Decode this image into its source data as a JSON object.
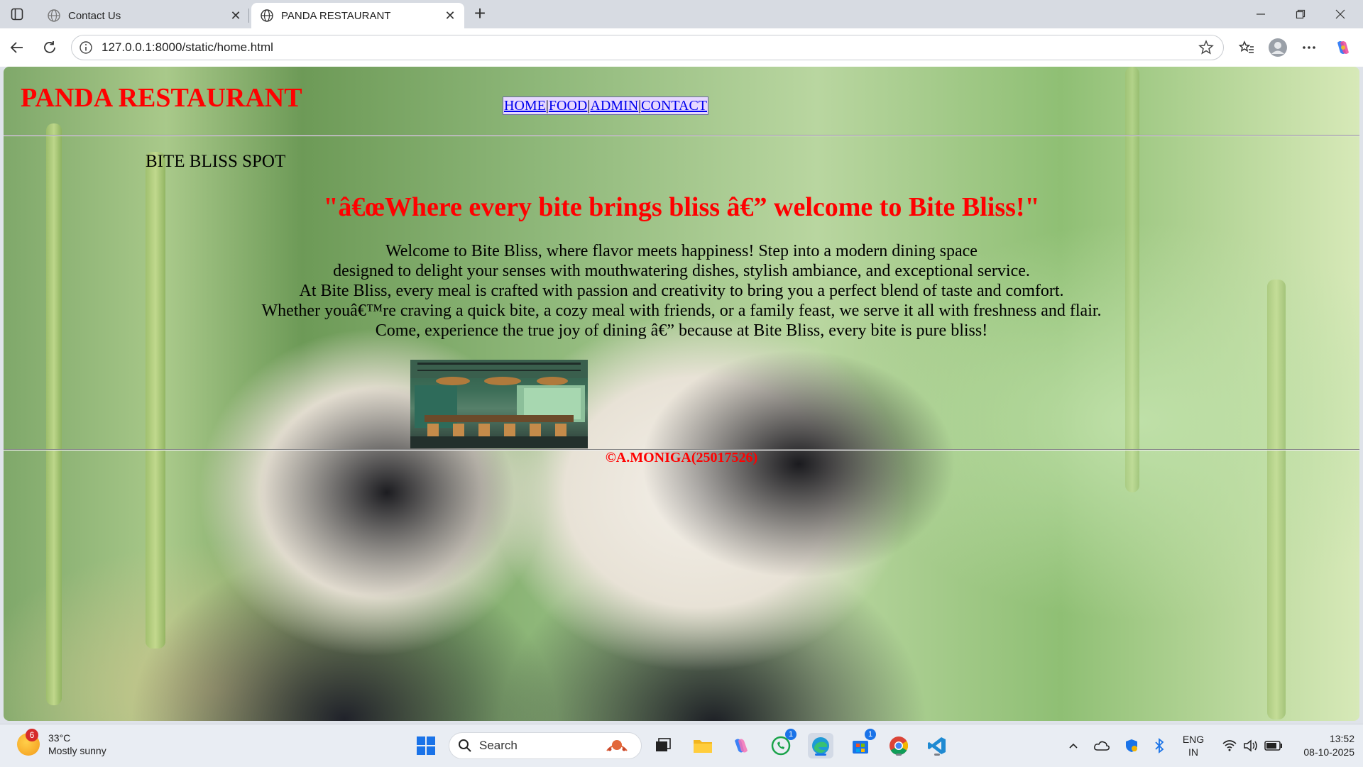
{
  "browser": {
    "tabs": [
      {
        "title": "Contact Us",
        "active": false
      },
      {
        "title": "PANDA RESTAURANT",
        "active": true
      }
    ],
    "url": "127.0.0.1:8000/static/home.html"
  },
  "page": {
    "site_title": "PANDA RESTAURANT",
    "nav": {
      "home": "HOME",
      "food": "FOOD",
      "admin": "ADMIN",
      "contact": "CONTACT",
      "separator": "|"
    },
    "spot_title": "BITE BLISS SPOT",
    "quote": "\"â€œWhere every bite brings bliss â€” welcome to Bite Bliss!\"",
    "welcome_lines": [
      "Welcome to Bite Bliss, where flavor meets happiness! Step into a modern dining space",
      "designed to delight your senses with mouthwatering dishes, stylish ambiance, and exceptional service.",
      "At Bite Bliss, every meal is crafted with passion and creativity to bring you a perfect blend of taste and comfort.",
      "Whether youâ€™re craving a quick bite, a cozy meal with friends, or a family feast, we serve it all with freshness and flair.",
      "Come, experience the true joy of dining â€” because at Bite Bliss, every bite is pure bliss!"
    ],
    "footer": "©A.MONIGA(25017526)"
  },
  "taskbar": {
    "weather": {
      "badge": "6",
      "temp": "33°C",
      "condition": "Mostly sunny"
    },
    "search_placeholder": "Search",
    "whatsapp_badge": "1",
    "store_badge": "1",
    "language": {
      "line1": "ENG",
      "line2": "IN"
    },
    "time": "13:52",
    "date": "08-10-2025"
  },
  "colors": {
    "title_red": "#ff0000",
    "link_blue": "#0000ee",
    "nav_bg": "#e6d8ff"
  }
}
